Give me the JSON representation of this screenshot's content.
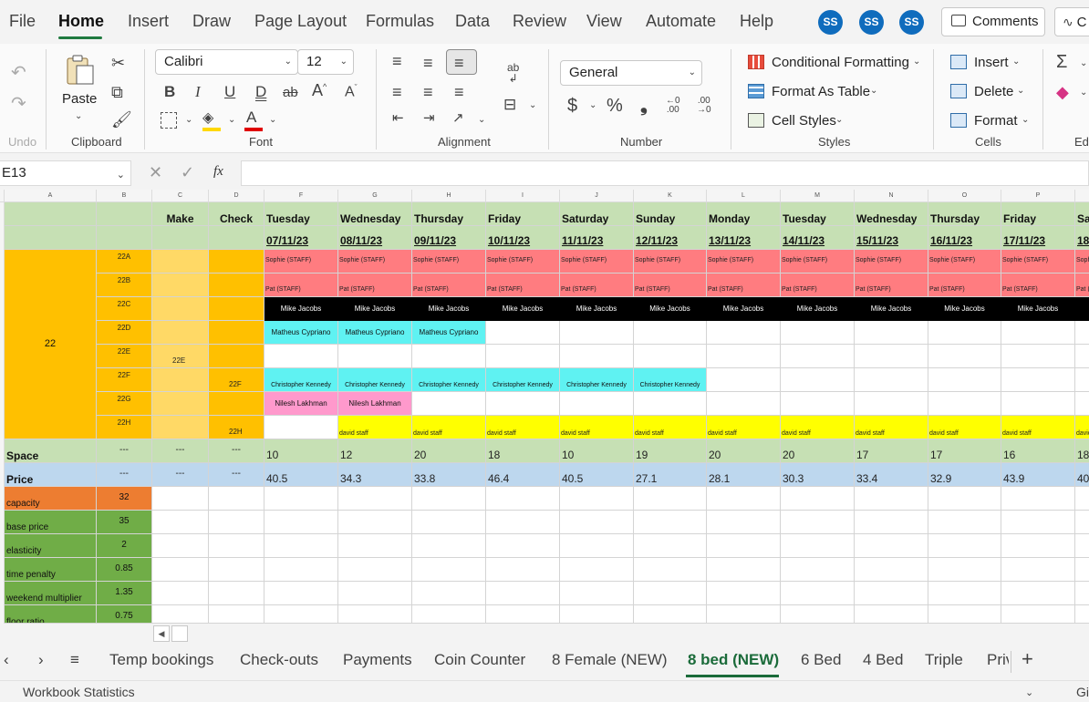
{
  "menu": {
    "items": [
      "File",
      "Home",
      "Insert",
      "Draw",
      "Page Layout",
      "Formulas",
      "Data",
      "Review",
      "View",
      "Automate",
      "Help"
    ],
    "active": "Home",
    "avatars": [
      "SS",
      "SS",
      "SS"
    ],
    "comments_label": "Comments",
    "share_label": "C"
  },
  "ribbon": {
    "undo_label": "Undo",
    "clipboard": {
      "paste_label": "Paste",
      "group_label": "Clipboard"
    },
    "font": {
      "family": "Calibri",
      "size": "12",
      "group_label": "Font"
    },
    "alignment": {
      "group_label": "Alignment"
    },
    "number": {
      "format": "General",
      "group_label": "Number",
      "currency_symbol": "$",
      "percent_symbol": "%"
    },
    "styles": {
      "conditional": "Conditional Formatting",
      "format_table": "Format As Table",
      "cell_styles": "Cell Styles",
      "group_label": "Styles"
    },
    "cells": {
      "insert": "Insert",
      "delete": "Delete",
      "format": "Format",
      "group_label": "Cells"
    },
    "editing": {
      "group_label": "Edi"
    }
  },
  "formula_bar": {
    "name_box": "E13",
    "fx": "fx",
    "value": ""
  },
  "grid": {
    "column_letters": [
      "A",
      "B",
      "C",
      "D",
      "F",
      "G",
      "H",
      "I",
      "J",
      "K",
      "L",
      "M",
      "N",
      "O",
      "P",
      ""
    ],
    "make_label": "Make",
    "check_label": "Check",
    "days": [
      "Tuesday",
      "Wednesday",
      "Thursday",
      "Friday",
      "Saturday",
      "Sunday",
      "Monday",
      "Tuesday",
      "Wednesday",
      "Thursday",
      "Friday",
      "Sa"
    ],
    "dates": [
      "07/11/23",
      "08/11/23",
      "09/11/23",
      "10/11/23",
      "11/11/23",
      "12/11/23",
      "13/11/23",
      "14/11/23",
      "15/11/23",
      "16/11/23",
      "17/11/23",
      "18"
    ],
    "room": "22",
    "beds": [
      "22A",
      "22B",
      "22C",
      "22D",
      "22E",
      "22F",
      "22G",
      "22H"
    ],
    "make_22E": "22E",
    "check_22F": "22F",
    "check_22H": "22H",
    "sophie": "Sophie (STAFF)",
    "pat": "Pat (STAFF)",
    "mike": "Mike Jacobs",
    "matheus": "Matheus Cypriano",
    "christopher": "Christopher Kennedy",
    "nilesh": "Nilesh Lakhman",
    "david": "david staff",
    "space_label": "Space",
    "price_label": "Price",
    "dash": "---",
    "space_values": [
      "10",
      "12",
      "20",
      "18",
      "10",
      "19",
      "20",
      "20",
      "17",
      "17",
      "16",
      "18"
    ],
    "price_values": [
      "40.5",
      "34.3",
      "33.8",
      "46.4",
      "40.5",
      "27.1",
      "28.1",
      "30.3",
      "33.4",
      "32.9",
      "43.9",
      "40"
    ],
    "params": [
      {
        "label": "capacity",
        "value": "32"
      },
      {
        "label": "base price",
        "value": "35"
      },
      {
        "label": "elasticity",
        "value": "2"
      },
      {
        "label": "time penalty",
        "value": "0.85"
      },
      {
        "label": "weekend multiplier",
        "value": "1.35"
      },
      {
        "label": "floor ratio",
        "value": "0.75"
      }
    ]
  },
  "sheet_tabs": [
    "Temp bookings",
    "Check-outs",
    "Payments",
    "Coin Counter",
    "8 Female (NEW)",
    "8 bed (NEW)",
    "6 Bed",
    "4 Bed",
    "Triple",
    "Priv"
  ],
  "active_sheet": "8 bed (NEW)",
  "status": {
    "left": "Workbook Statistics",
    "right": "Gi"
  },
  "colors": {
    "green_header": "#c6e0b4",
    "orange_room": "#ffc000",
    "light_orange": "#ffd966",
    "salmon": "#ff7c80",
    "black": "#000000",
    "cyan": "#5ff2f2",
    "pink": "#ff99cc",
    "yellow": "#ffff00",
    "price_blue": "#bdd7ee",
    "param_green": "#70ad47",
    "capacity_orange": "#ed7d31",
    "excel_green": "#1f7a3f"
  }
}
